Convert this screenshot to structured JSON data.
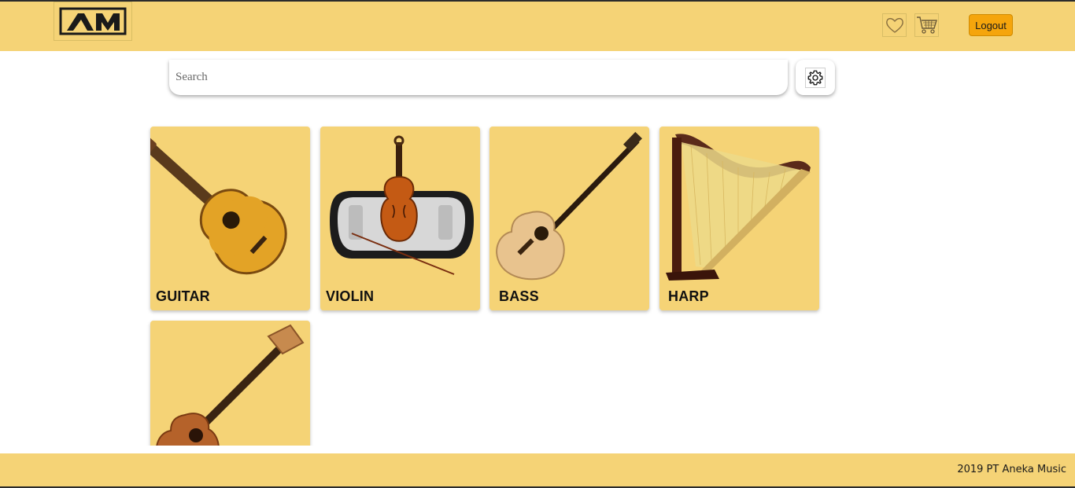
{
  "header": {
    "logo_text": "AM",
    "logout_label": "Logout",
    "icons": [
      "heart-icon",
      "cart-icon"
    ]
  },
  "search": {
    "placeholder": "Search",
    "value": ""
  },
  "settings": {
    "icon": "gear-icon"
  },
  "categories": [
    {
      "label": "GUITAR",
      "icon": "guitar-image"
    },
    {
      "label": "VIOLIN",
      "icon": "violin-image"
    },
    {
      "label": "BASS",
      "icon": "bass-image"
    },
    {
      "label": "HARP",
      "icon": "harp-image"
    },
    {
      "label": "",
      "icon": "ukulele-image"
    }
  ],
  "footer": {
    "text": "2019 PT Aneka Music"
  },
  "colors": {
    "brand": "#f5d376",
    "logout": "#f5a50c"
  }
}
